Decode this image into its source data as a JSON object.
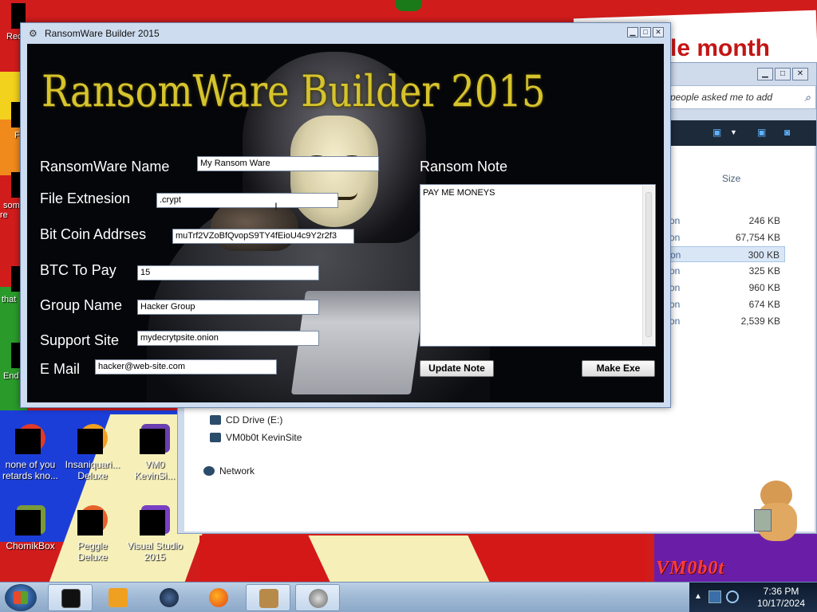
{
  "wallpaper": {
    "banner_text": "le month",
    "logo_text": "VM0b0t"
  },
  "desktop_icons": [
    {
      "label": "none of you retards kno...",
      "color": "#e13a2a"
    },
    {
      "label": "Insaniquari... Deluxe",
      "color": "#f3a020"
    },
    {
      "label": "VM0 KevinSi...",
      "color": "#6a3fb0"
    },
    {
      "label": "ChomikBox",
      "color": "#7a9a3a"
    },
    {
      "label": "Peggle Deluxe",
      "color": "#e8602a"
    },
    {
      "label": "Visual Studio 2015",
      "color": "#7a3fc4"
    }
  ],
  "partial_icons": [
    "Rec",
    "F",
    "som re",
    "that",
    "End"
  ],
  "explorer": {
    "search_placeholder": "people asked me to add",
    "size_header": "Size",
    "rows": [
      {
        "name": "on",
        "size": "246 KB",
        "selected": false
      },
      {
        "name": "on",
        "size": "67,754 KB",
        "selected": false
      },
      {
        "name": "on",
        "size": "300 KB",
        "selected": true
      },
      {
        "name": "on",
        "size": "325 KB",
        "selected": false
      },
      {
        "name": "on",
        "size": "960 KB",
        "selected": false
      },
      {
        "name": "on",
        "size": "674 KB",
        "selected": false
      },
      {
        "name": "on",
        "size": "2,539 KB",
        "selected": false
      }
    ],
    "nav": {
      "cd_drive": "CD Drive (E:)",
      "vm_site": "VM0b0t KevinSite",
      "network": "Network"
    }
  },
  "dialog": {
    "window_title": "RansomWare Builder 2015",
    "app_title": "RansomWare Builder 2015",
    "fields": {
      "name_label": "RansomWare Name",
      "name_value": "My Ransom Ware",
      "ext_label": "File Extnesion",
      "ext_value": ".crypt",
      "btc_addr_label": "Bit Coin Addrses",
      "btc_addr_value": "muTrf2VZoBfQvopS9TY4fEioU4c9Y2r2f3",
      "btc_pay_label": "BTC To Pay",
      "btc_pay_value": "15",
      "group_label": "Group Name",
      "group_value": "Hacker Group",
      "support_label": "Support Site",
      "support_value": "mydecrytpsite.onion",
      "email_label": "E Mail",
      "email_value": "hacker@web-site.com"
    },
    "note_label": "Ransom Note",
    "note_value": "PAY ME MONEYS",
    "update_button": "Update Note",
    "make_button": "Make Exe"
  },
  "taskbar": {
    "time": "7:36 PM",
    "date": "10/17/2024"
  }
}
